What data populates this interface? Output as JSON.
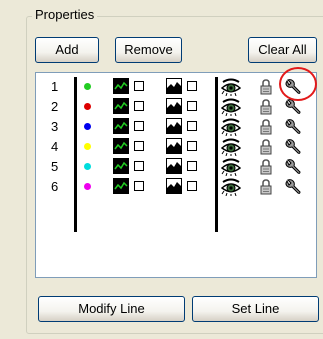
{
  "group": {
    "title": "Properties"
  },
  "toolbar": {
    "add_label": "Add",
    "remove_label": "Remove",
    "clear_all_label": "Clear All"
  },
  "footer": {
    "modify_label": "Modify Line",
    "set_label": "Set Line"
  },
  "lines": [
    {
      "num": "1",
      "color": "#22cc22"
    },
    {
      "num": "2",
      "color": "#dd0000"
    },
    {
      "num": "3",
      "color": "#0000ee"
    },
    {
      "num": "4",
      "color": "#ffff00"
    },
    {
      "num": "5",
      "color": "#00dddd"
    },
    {
      "num": "6",
      "color": "#ee00ee"
    }
  ],
  "icons": {
    "line_chart": "line-chart-icon",
    "area_chart": "area-chart-icon",
    "visibility": "eye-icon",
    "lock": "lock-icon",
    "settings": "wrench-icon"
  },
  "highlight_color": "#e31a1a"
}
